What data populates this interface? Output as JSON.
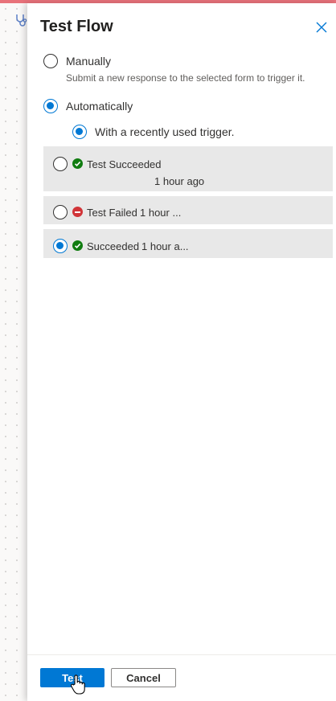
{
  "panel": {
    "title": "Test Flow",
    "close_icon": "close-icon"
  },
  "options": {
    "manual": {
      "label": "Manually",
      "description": "Submit a new response to the selected form to trigger it.",
      "selected": false
    },
    "automatic": {
      "label": "Automatically",
      "selected": true,
      "sub_option": {
        "label": "With a recently used trigger.",
        "selected": true
      }
    }
  },
  "runs": [
    {
      "status": "Test Succeeded",
      "time": "1 hour ago",
      "status_icon": "success-icon",
      "selected": false
    },
    {
      "status": "Test Failed",
      "time": "1 hour ...",
      "status_icon": "failed-icon",
      "selected": false
    },
    {
      "status": "Succeeded",
      "time": "1 hour a...",
      "status_icon": "success-icon",
      "selected": true
    }
  ],
  "footer": {
    "primary_label": "Test",
    "secondary_label": "Cancel"
  },
  "colors": {
    "accent": "#0078d4",
    "success": "#107c10",
    "error": "#d13438",
    "top_strip": "#e8727a"
  }
}
